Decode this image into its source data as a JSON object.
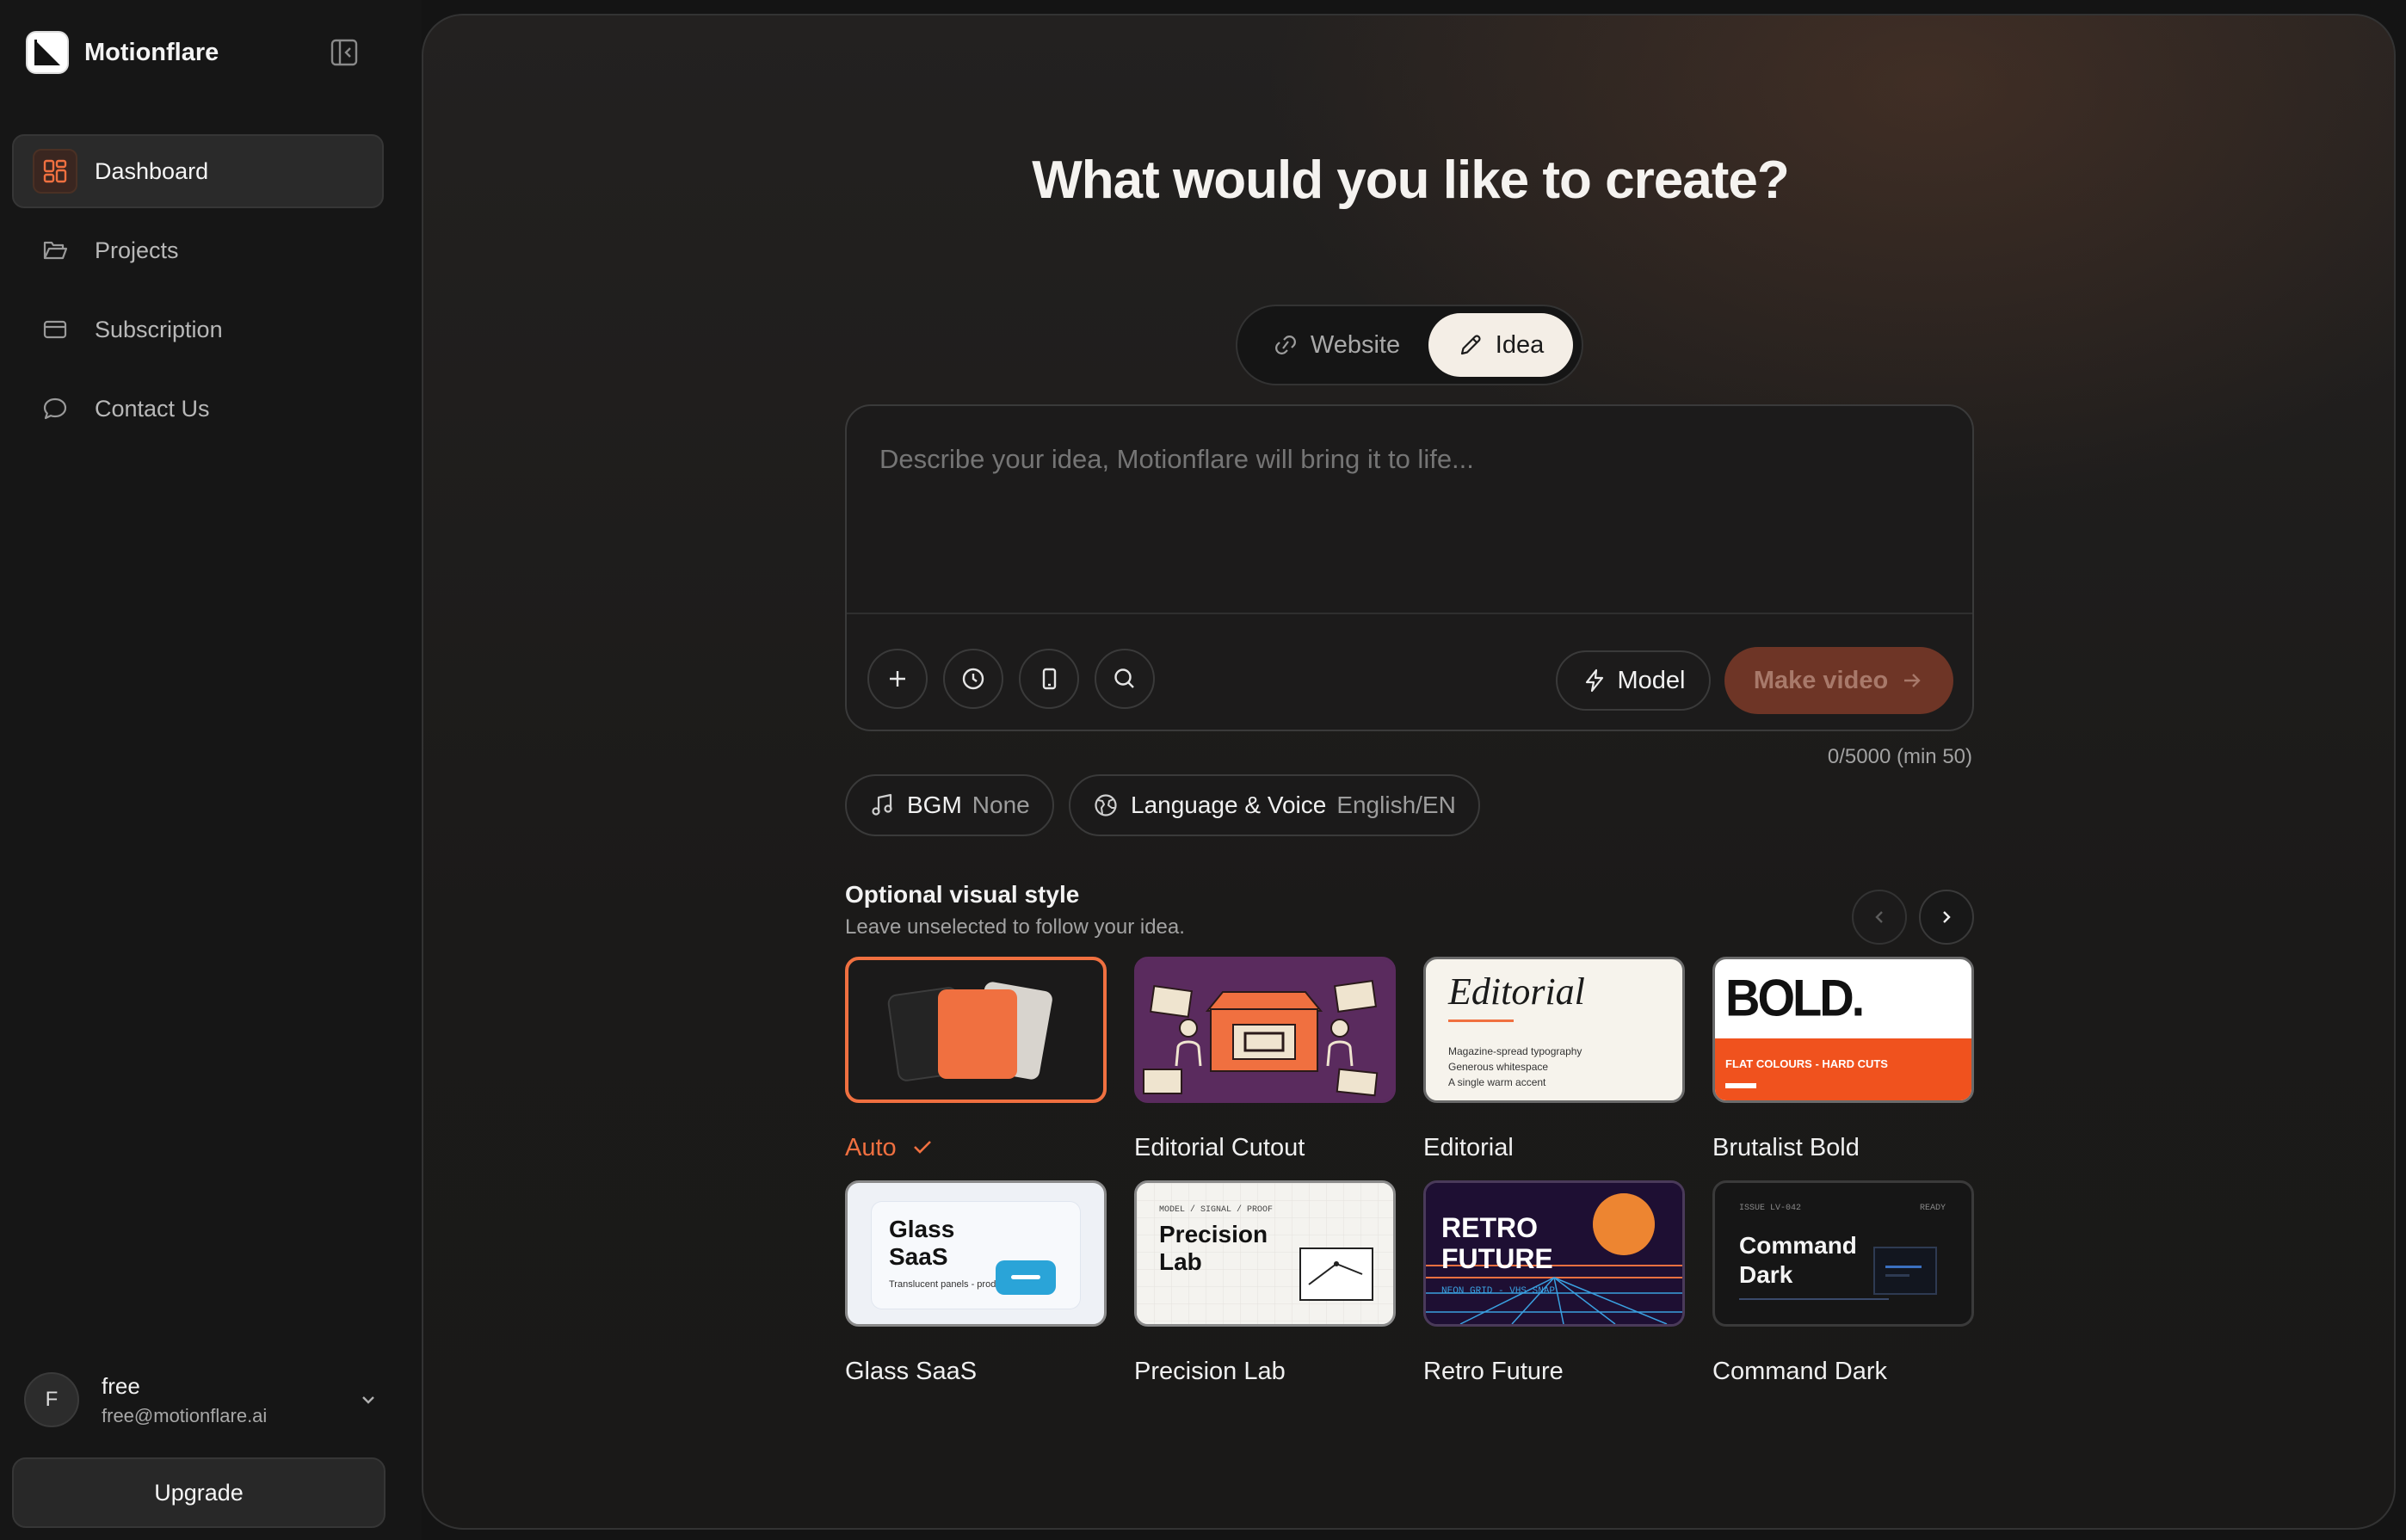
{
  "app": {
    "name": "Motionflare"
  },
  "sidebar": {
    "items": [
      {
        "label": "Dashboard",
        "icon": "dashboard-icon",
        "active": true
      },
      {
        "label": "Projects",
        "icon": "folder-icon",
        "active": false
      },
      {
        "label": "Subscription",
        "icon": "credit-card-icon",
        "active": false
      },
      {
        "label": "Contact Us",
        "icon": "chat-bubble-icon",
        "active": false
      }
    ],
    "user": {
      "initial": "F",
      "plan": "free",
      "email": "free@motionflare.ai"
    },
    "upgrade_label": "Upgrade"
  },
  "main": {
    "headline": "What would you like to create?",
    "modes": {
      "website": "Website",
      "idea": "Idea",
      "selected": "Idea"
    },
    "composer": {
      "placeholder": "Describe your idea, Motionflare will bring it to life...",
      "model_label": "Model",
      "make_label": "Make video",
      "counter": "0/5000 (min 50)"
    },
    "options": {
      "bgm_label": "BGM",
      "bgm_value": "None",
      "lang_label": "Language & Voice",
      "lang_value": "English/EN"
    },
    "styles": {
      "title": "Optional visual style",
      "subtitle": "Leave unselected to follow your idea.",
      "cards": [
        {
          "label": "Auto",
          "selected": true
        },
        {
          "label": "Editorial Cutout",
          "selected": false
        },
        {
          "label": "Editorial",
          "selected": false
        },
        {
          "label": "Brutalist Bold",
          "selected": false
        },
        {
          "label": "Glass SaaS",
          "selected": false
        },
        {
          "label": "Precision Lab",
          "selected": false
        },
        {
          "label": "Retro Future",
          "selected": false
        },
        {
          "label": "Command Dark",
          "selected": false
        }
      ],
      "thumbs": {
        "editorial_title": "Editorial",
        "editorial_lines": [
          "Magazine-spread typography",
          "Generous whitespace",
          "A single warm accent"
        ],
        "brutalist_title": "BOLD.",
        "brutalist_band": "FLAT COLOURS - HARD CUTS",
        "glass_title": "Glass SaaS",
        "glass_sub": "Translucent panels - product depth",
        "precision_kicker": "MODEL / SIGNAL / PROOF",
        "precision_title": "Precision Lab",
        "retro_title": "RETRO FUTURE",
        "retro_sub": "NEON GRID - VHS SNAP",
        "command_issue": "ISSUE LV-042",
        "command_status": "READY",
        "command_title": "Command Dark"
      }
    }
  },
  "colors": {
    "accent": "#f07040",
    "make_button": "#6e3526",
    "panel": "#1c1b1b"
  }
}
